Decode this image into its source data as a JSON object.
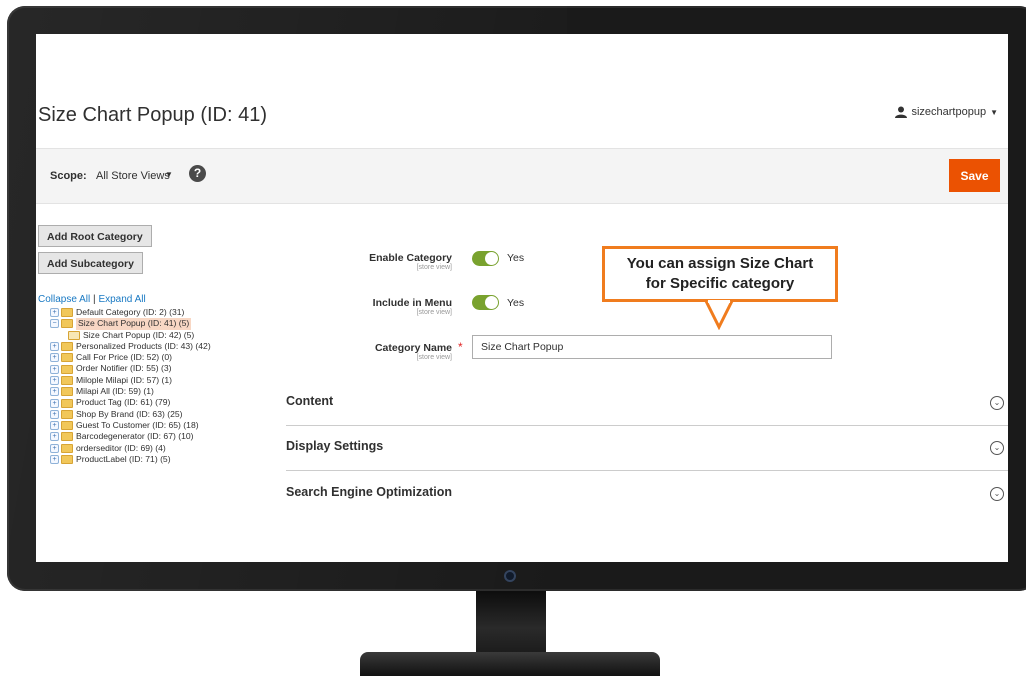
{
  "page": {
    "title": "Size Chart Popup (ID: 41)",
    "user": "sizechartpopup"
  },
  "scope": {
    "label": "Scope:",
    "value": "All Store Views",
    "help_icon": "question-circle-icon"
  },
  "actions": {
    "save_label": "Save"
  },
  "tree_actions": {
    "add_root": "Add Root Category",
    "add_sub": "Add Subcategory",
    "collapse_all": "Collapse All",
    "separator": "|",
    "expand_all": "Expand All"
  },
  "tree": [
    {
      "label": "Default Category (ID: 2) (31)",
      "level": 0,
      "selected": false
    },
    {
      "label": "Size Chart Popup (ID: 41) (5)",
      "level": 0,
      "selected": true
    },
    {
      "label": "Size Chart Popup (ID: 42) (5)",
      "level": 1,
      "selected": false
    },
    {
      "label": "Personalized Products (ID: 43) (42)",
      "level": 0,
      "selected": false
    },
    {
      "label": "Call For Price (ID: 52) (0)",
      "level": 0,
      "selected": false
    },
    {
      "label": "Order Notifier (ID: 55) (3)",
      "level": 0,
      "selected": false
    },
    {
      "label": "Milople Milapi (ID: 57) (1)",
      "level": 0,
      "selected": false
    },
    {
      "label": "Milapi All (ID: 59) (1)",
      "level": 0,
      "selected": false
    },
    {
      "label": "Product Tag (ID: 61) (79)",
      "level": 0,
      "selected": false
    },
    {
      "label": "Shop By Brand (ID: 63) (25)",
      "level": 0,
      "selected": false
    },
    {
      "label": "Guest To Customer (ID: 65) (18)",
      "level": 0,
      "selected": false
    },
    {
      "label": "Barcodegenerator (ID: 67) (10)",
      "level": 0,
      "selected": false
    },
    {
      "label": "orderseditor (ID: 69) (4)",
      "level": 0,
      "selected": false
    },
    {
      "label": "ProductLabel (ID: 71) (5)",
      "level": 0,
      "selected": false
    }
  ],
  "form": {
    "enable_category": {
      "label": "Enable Category",
      "scope": "[store view]",
      "value": "Yes"
    },
    "include_in_menu": {
      "label": "Include in Menu",
      "scope": "[store view]",
      "value": "Yes"
    },
    "category_name": {
      "label": "Category Name",
      "scope": "[store view]",
      "required_mark": "*",
      "value": "Size Chart Popup"
    }
  },
  "sections": [
    {
      "title": "Content"
    },
    {
      "title": "Display Settings"
    },
    {
      "title": "Search Engine Optimization"
    }
  ],
  "callout": {
    "line1": "You can assign Size Chart",
    "line2": "for Specific category"
  },
  "colors": {
    "save_button": "#eb5202",
    "toggle_on": "#79a22e",
    "callout_border": "#f07c1e",
    "link": "#1979c3"
  }
}
